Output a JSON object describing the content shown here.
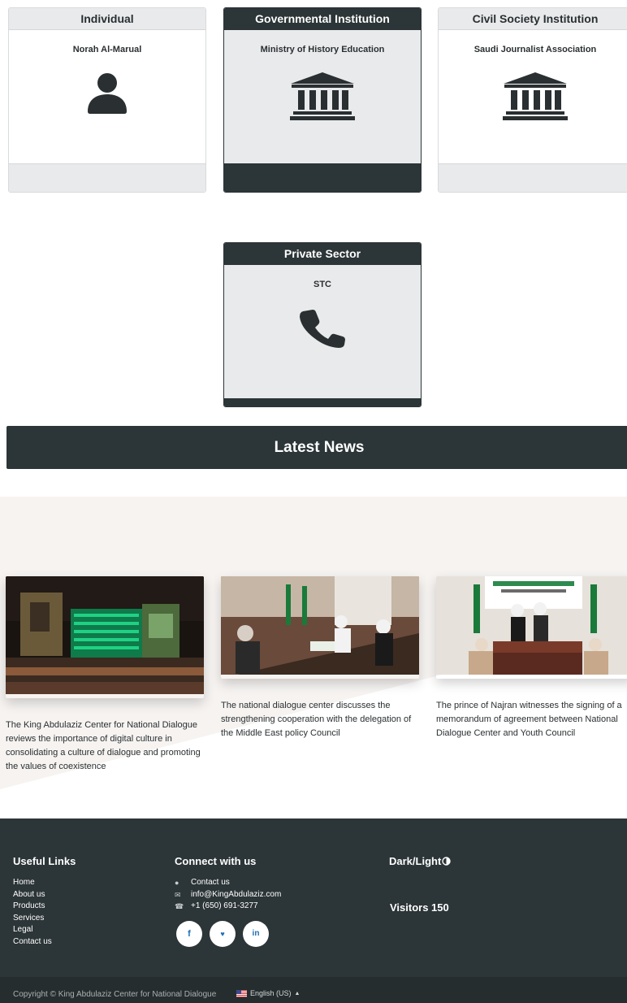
{
  "cards": [
    {
      "header": "Individual",
      "name": "Norah Al-Marual",
      "icon": "user-icon",
      "style": "light"
    },
    {
      "header": "Governmental Institution",
      "name": "Ministry of History Education",
      "icon": "bank-icon",
      "style": "dark"
    },
    {
      "header": "Civil Society Institution",
      "name": "Saudi Journalist Association",
      "icon": "bank-icon",
      "style": "light"
    },
    {
      "header": "Private Sector",
      "name": "STC",
      "icon": "phone-icon",
      "style": "dark"
    }
  ],
  "news": {
    "title": "Latest News",
    "items": [
      {
        "text": "The King Abdulaziz Center for National Dialogue reviews the importance of digital culture in consolidating a culture of dialogue and promoting the values of coexistence",
        "image": "building-night-photo"
      },
      {
        "text": "The national dialogue center discusses the strengthening cooperation with the delegation of the Middle East policy Council",
        "image": "meeting-photo"
      },
      {
        "text": "The prince of Najran witnesses the signing of a memorandum of agreement between National Dialogue Center and Youth Council",
        "image": "signing-ceremony-photo"
      }
    ]
  },
  "footer": {
    "useful_links_title": "Useful Links",
    "links": [
      "Home",
      "About us",
      "Products",
      "Services",
      "Legal",
      "Contact us"
    ],
    "connect_title": "Connect with us",
    "contact": [
      {
        "icon": "chat-icon",
        "text": "Contact us"
      },
      {
        "icon": "mail-icon",
        "text": "info@KingAbdulaziz.com"
      },
      {
        "icon": "phone-icon",
        "text": "+1 (650) 691-3277"
      }
    ],
    "social": [
      {
        "icon": "facebook-icon",
        "label": "f"
      },
      {
        "icon": "twitter-icon",
        "label": "♥"
      },
      {
        "icon": "linkedin-icon",
        "label": "in"
      }
    ],
    "theme_toggle": "Dark/Light",
    "visitors": "Visitors 150",
    "copyright": "Copyright © King Abdulaziz Center for National Dialogue",
    "language": "English (US)"
  },
  "colors": {
    "dark": "#2c3537",
    "light": "#e9eaec",
    "accent_link": "#1f6fb3"
  }
}
